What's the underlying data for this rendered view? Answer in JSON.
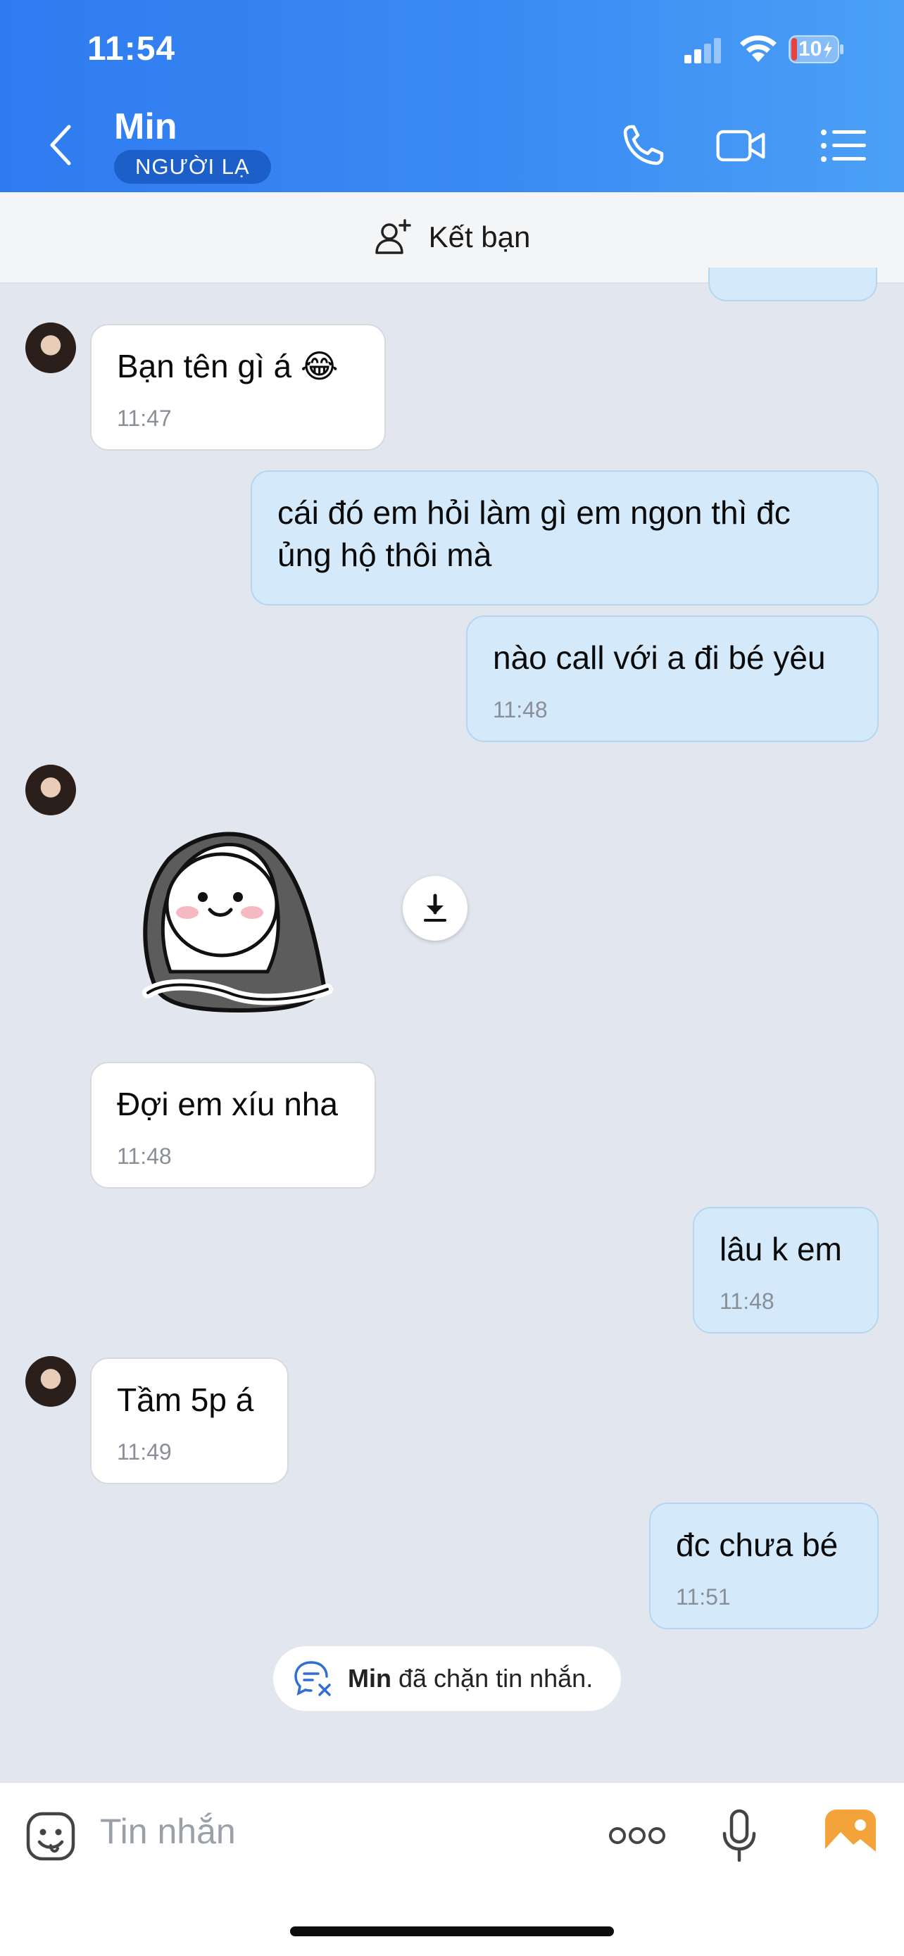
{
  "status_bar": {
    "time": "11:54",
    "battery": "10"
  },
  "header": {
    "contact_name": "Min",
    "badge": "NGƯỜI LẠ"
  },
  "friend_bar": {
    "label": "Kết bạn"
  },
  "messages": [
    {
      "text": "Bạn tên gì á 😂",
      "time": "11:47"
    },
    {
      "text": "cái đó em hỏi làm gì em ngon thì đc ủng hộ thôi mà"
    },
    {
      "text": "nào call với a đi bé yêu",
      "time": "11:48"
    },
    {
      "text": "Đợi em xíu nha",
      "time": "11:48"
    },
    {
      "text": "lâu k em",
      "time": "11:48"
    },
    {
      "text": "Tầm 5p á",
      "time": "11:49"
    },
    {
      "text": "đc chưa bé",
      "time": "11:51"
    }
  ],
  "notice": {
    "name": "Min",
    "text": " đã chặn tin nhắn."
  },
  "composer": {
    "placeholder": "Tin nhắn"
  },
  "colors": {
    "header_blue": "#3a8af3",
    "outgoing_bubble": "#d4eafb",
    "chat_bg": "#e2e6ee"
  }
}
